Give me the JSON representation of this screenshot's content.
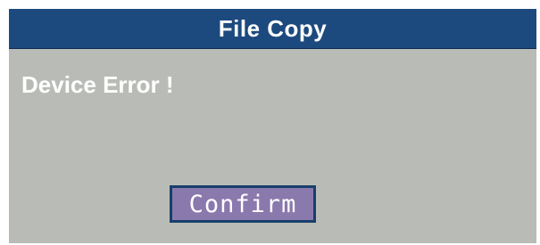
{
  "dialog": {
    "title": "File Copy",
    "message": "Device Error !",
    "confirm_label": "Confirm"
  },
  "colors": {
    "titlebar": "#1c4a7e",
    "background": "#b9bcb6",
    "button": "#8a79ad",
    "button_border": "#173f6b",
    "text": "#ffffff"
  }
}
